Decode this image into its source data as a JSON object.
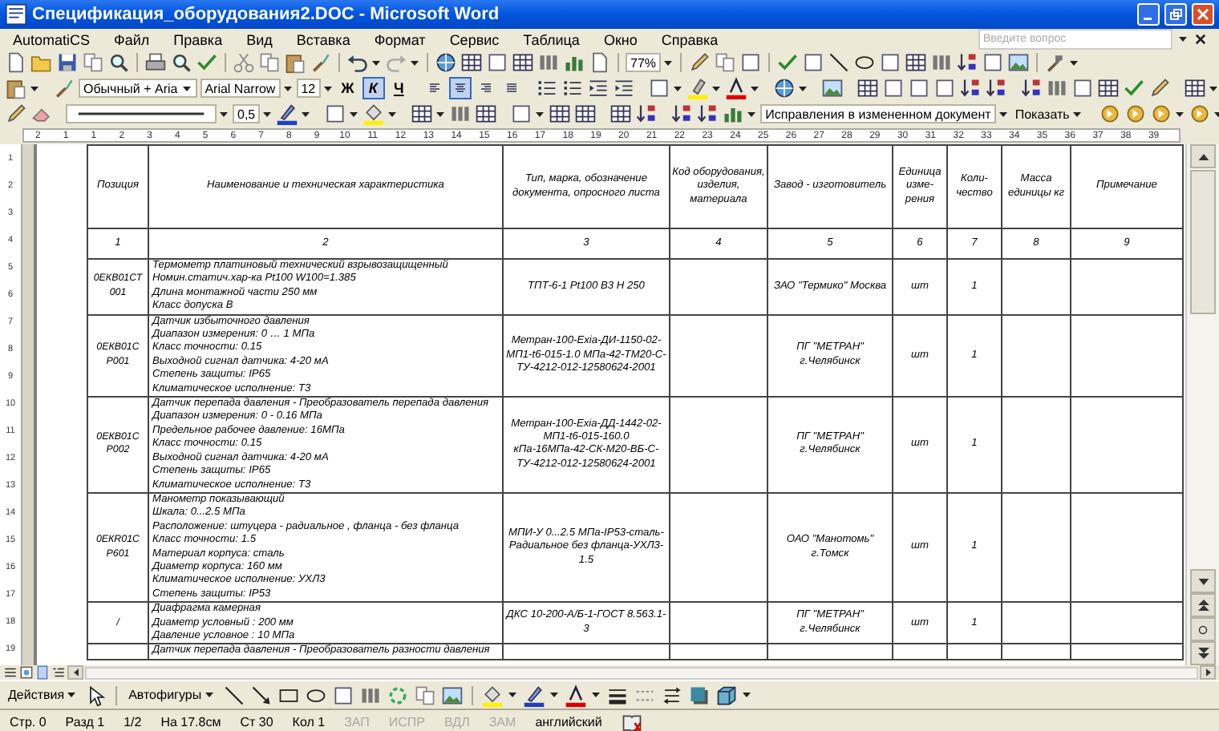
{
  "window": {
    "title": "Спецификация_оборудования2.DOC - Microsoft Word"
  },
  "menu": [
    "AutomatiCS",
    "Файл",
    "Правка",
    "Вид",
    "Вставка",
    "Формат",
    "Сервис",
    "Таблица",
    "Окно",
    "Справка"
  ],
  "help_box": {
    "placeholder": "Введите вопрос"
  },
  "toolbar": {
    "zoom": "77%",
    "style": "Обычный + Aria",
    "font": "Arial Narrow",
    "size": "12",
    "line_weight": "0,5",
    "review_mode": "Исправления в измененном документ",
    "show_button": "Показать"
  },
  "format_buttons": [
    {
      "label": "Ж",
      "selected": false
    },
    {
      "label": "К",
      "selected": true
    },
    {
      "label": "Ч",
      "selected": false
    }
  ],
  "align_buttons": [
    {
      "selected": false
    },
    {
      "selected": true
    },
    {
      "selected": false
    },
    {
      "selected": false
    }
  ],
  "ruler": [
    "2",
    "1",
    "1",
    "2",
    "3",
    "4",
    "5",
    "6",
    "7",
    "8",
    "9",
    "10",
    "11",
    "12",
    "13",
    "14",
    "15",
    "16",
    "17",
    "18",
    "19",
    "20",
    "21",
    "22",
    "23",
    "24",
    "25",
    "26",
    "27",
    "28",
    "29",
    "30",
    "31",
    "32",
    "33",
    "34",
    "35",
    "36",
    "37",
    "38",
    "39"
  ],
  "vertical_ruler": [
    "1",
    "2",
    "3",
    "4",
    "5",
    "6",
    "7",
    "8",
    "9",
    "10",
    "11",
    "12",
    "13",
    "14",
    "15",
    "16",
    "17",
    "18",
    "19"
  ],
  "table": {
    "columns": [
      "Позиция",
      "Наименование и техническая характеристика",
      "Тип, марка, обозначение документа, опросного листа",
      "Код оборудования, изделия, материала",
      "Завод - изготовитель",
      "Единица изме-рения",
      "Коли-чество",
      "Масса единицы кг",
      "Примечание"
    ],
    "column_numbers": [
      "1",
      "2",
      "3",
      "4",
      "5",
      "6",
      "7",
      "8",
      "9"
    ],
    "rows": [
      {
        "position": "0ЕКВ01СТ 001",
        "description": [
          "Термометр платиновый технический взрывозащищенный",
          "Номин.статич.хар-ка Pt100 W100=1.385",
          "Длина монтажной части 250 мм",
          "Класс допуска B"
        ],
        "type": "ТПТ-6-1 Pt100 B3 H 250",
        "plant": "ЗАО \"Термико\" Москва",
        "unit": "шт",
        "quantity": "1"
      },
      {
        "position": "0ЕКВ01С Р001",
        "description": [
          "Датчик избыточного давления",
          "Диапазон измерения: 0 … 1 МПа",
          "Класс точности: 0.15",
          "Выходной сигнал датчика: 4-20 мА",
          "Степень защиты: IP65",
          "Климатическое исполнение: Т3"
        ],
        "type": "Метран-100-Exia-ДИ-1150-02-МП1-t6-015-1.0 МПа-42-ТМ20-С-ТУ-4212-012-12580624-2001",
        "plant": "ПГ \"МЕТРАН\" г.Челябинск",
        "unit": "шт",
        "quantity": "1"
      },
      {
        "position": "0ЕКВ01С Р002",
        "description": [
          "Датчик перепада давления - Преобразователь перепада давления",
          "Диапазон измерения: 0 - 0.16 МПа",
          "Предельное рабочее давление: 16МПа",
          "Класс точности: 0.15",
          "Выходной сигнал датчика: 4-20 мА",
          "Степень защиты: IP65",
          "Климатическое исполнение: Т3"
        ],
        "type": "Метран-100-Exia-ДД-1442-02-МП1-t6-015-160.0 кПа-16МПа-42-СК-М20-ВБ-С-ТУ-4212-012-12580624-2001",
        "plant": "ПГ \"МЕТРАН\" г.Челябинск",
        "unit": "шт",
        "quantity": "1"
      },
      {
        "position": "0ЕКR01С Р601",
        "description": [
          "Манометр показывающий",
          "Шкала: 0...2.5 МПа",
          "Расположение: штуцера - радиальное , фланца - без фланца",
          "Класс точности: 1.5",
          "Материал корпуса: сталь",
          "Диаметр корпуса: 160 мм",
          "Климатическое исполнение: УХЛ3",
          "Степень защиты: IP53"
        ],
        "type": "МПИ-У 0...2.5 МПа-IP53-сталь-Радиальное без фланца-УХЛ3-1.5",
        "plant": "ОАО \"Манотомь\" г.Томск",
        "unit": "шт",
        "quantity": "1"
      },
      {
        "position": "/",
        "description": [
          "Диафрагма камерная",
          "Диаметр условный : 200 мм",
          "Давление условное : 10 МПа"
        ],
        "type": "ДКС 10-200-А/Б-1-ГОСТ 8.563.1-3",
        "plant": "ПГ \"МЕТРАН\" г.Челябинск",
        "unit": "шт",
        "quantity": "1"
      },
      {
        "description": [
          "Датчик перепада давления - Преобразователь разности давления"
        ]
      }
    ]
  },
  "drawing_toolbar": {
    "actions": "Действия",
    "autoshapes": "Автофигуры"
  },
  "status_bar": [
    {
      "text": "Стр. 0",
      "disabled": false
    },
    {
      "text": "Разд 1",
      "disabled": false
    },
    {
      "text": "1/2",
      "disabled": false
    },
    {
      "text": "На 17.8см",
      "disabled": false
    },
    {
      "text": "Ст 30",
      "disabled": false
    },
    {
      "text": "Кол 1",
      "disabled": false
    },
    {
      "text": "ЗАП",
      "disabled": true
    },
    {
      "text": "ИСПР",
      "disabled": true
    },
    {
      "text": "ВДЛ",
      "disabled": true
    },
    {
      "text": "ЗАМ",
      "disabled": true
    },
    {
      "text": "английский",
      "disabled": false
    }
  ]
}
